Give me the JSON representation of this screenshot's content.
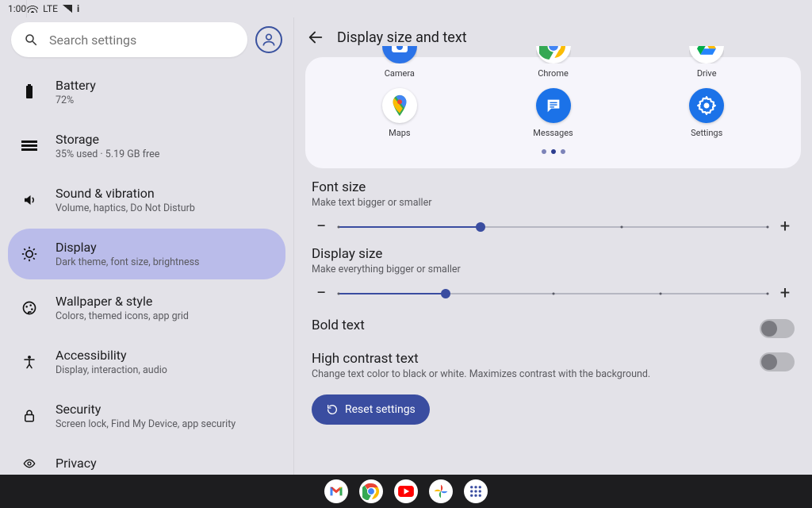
{
  "status": {
    "time": "1:00",
    "network": "LTE"
  },
  "search": {
    "placeholder": "Search settings"
  },
  "sidebar": {
    "items": [
      {
        "icon": "battery-icon",
        "title": "Battery",
        "sub": "72%"
      },
      {
        "icon": "storage-icon",
        "title": "Storage",
        "sub": "35% used · 5.19 GB free"
      },
      {
        "icon": "sound-icon",
        "title": "Sound & vibration",
        "sub": "Volume, haptics, Do Not Disturb"
      },
      {
        "icon": "display-icon",
        "title": "Display",
        "sub": "Dark theme, font size, brightness",
        "selected": true
      },
      {
        "icon": "wallpaper-icon",
        "title": "Wallpaper & style",
        "sub": "Colors, themed icons, app grid"
      },
      {
        "icon": "accessibility-icon",
        "title": "Accessibility",
        "sub": "Display, interaction, audio"
      },
      {
        "icon": "security-icon",
        "title": "Security",
        "sub": "Screen lock, Find My Device, app security"
      },
      {
        "icon": "privacy-icon",
        "title": "Privacy",
        "sub": ""
      }
    ]
  },
  "detail": {
    "title": "Display size and text",
    "preview": {
      "row1": [
        {
          "label": "Camera",
          "color": "#2b73e8"
        },
        {
          "label": "Chrome",
          "color": "#ffffff"
        },
        {
          "label": "Drive",
          "color": "#ffffff"
        }
      ],
      "row2": [
        {
          "label": "Maps",
          "color": "#ffffff"
        },
        {
          "label": "Messages",
          "color": "#1b72e8"
        },
        {
          "label": "Settings",
          "color": "#1b72e8"
        }
      ],
      "page_index": 1,
      "page_count": 3
    },
    "font_size": {
      "title": "Font size",
      "sub": "Make text bigger or smaller",
      "value": 33,
      "ticks": [
        0,
        33,
        66,
        100
      ]
    },
    "display_size": {
      "title": "Display size",
      "sub": "Make everything bigger or smaller",
      "value": 25,
      "ticks": [
        0,
        25,
        50,
        75,
        100
      ]
    },
    "bold": {
      "title": "Bold text",
      "on": false
    },
    "contrast": {
      "title": "High contrast text",
      "sub": "Change text color to black or white. Maximizes contrast with the background.",
      "on": false
    },
    "reset_label": "Reset settings"
  },
  "taskbar": {
    "apps": [
      "gmail",
      "chrome",
      "youtube",
      "photos",
      "apps"
    ]
  }
}
